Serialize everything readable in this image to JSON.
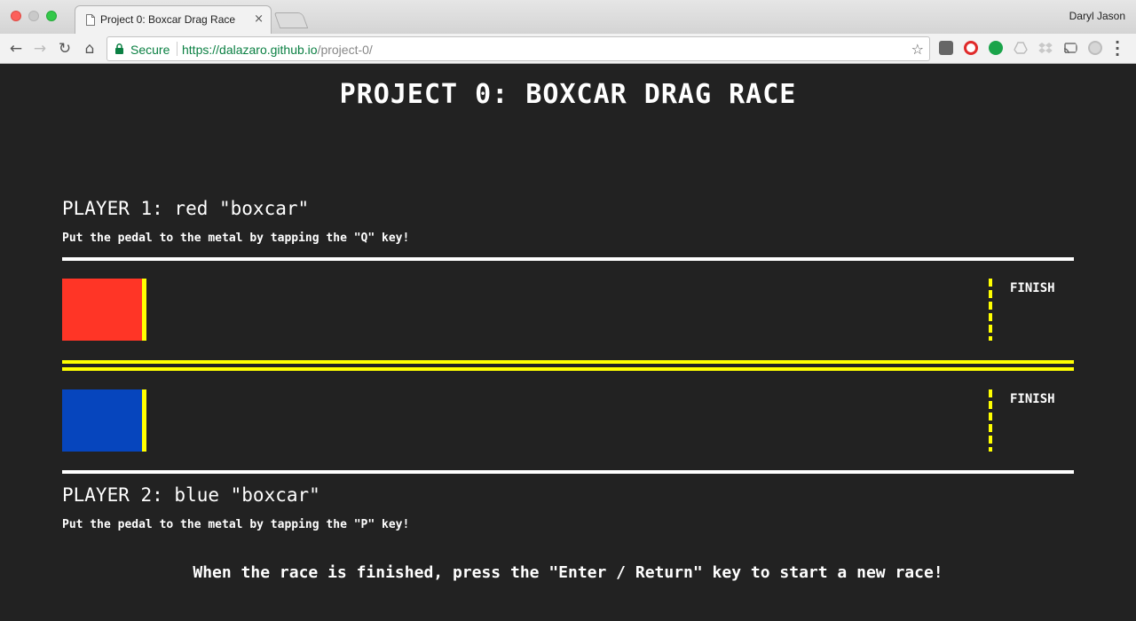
{
  "browser": {
    "tab_title": "Project 0: Boxcar Drag Race",
    "tab_close": "×",
    "profile_name": "Daryl Jason",
    "security_label": "Secure",
    "url_scheme": "https://",
    "url_host": "dalazaro.github.io",
    "url_path": "/project-0/",
    "icons": [
      "back-arrow-icon",
      "forward-arrow-icon",
      "reload-icon",
      "home-icon",
      "lock-icon",
      "star-icon",
      "pocket-icon",
      "opera-icon",
      "grammarly-icon",
      "drive-icon",
      "dropbox-icon",
      "cast-icon",
      "extension-icon",
      "menu-icon"
    ]
  },
  "page": {
    "title": "PROJECT 0: BOXCAR DRAG RACE",
    "player1": {
      "heading": "PLAYER 1: red \"boxcar\"",
      "instruction": "Put the pedal to the metal by tapping the \"Q\" key!",
      "car_color": "#ff3526",
      "finish_label": "FINISH"
    },
    "player2": {
      "heading": "PLAYER 2: blue \"boxcar\"",
      "instruction": "Put the pedal to the metal by tapping the \"P\" key!",
      "car_color": "#0645bd",
      "finish_label": "FINISH"
    },
    "footer": "When the race is finished, press the \"Enter / Return\" key to start a new race!"
  },
  "colors": {
    "background": "#222222",
    "track_border": "#ffffff",
    "lane_divider": "#ffff00",
    "bumper": "#ffff00"
  }
}
